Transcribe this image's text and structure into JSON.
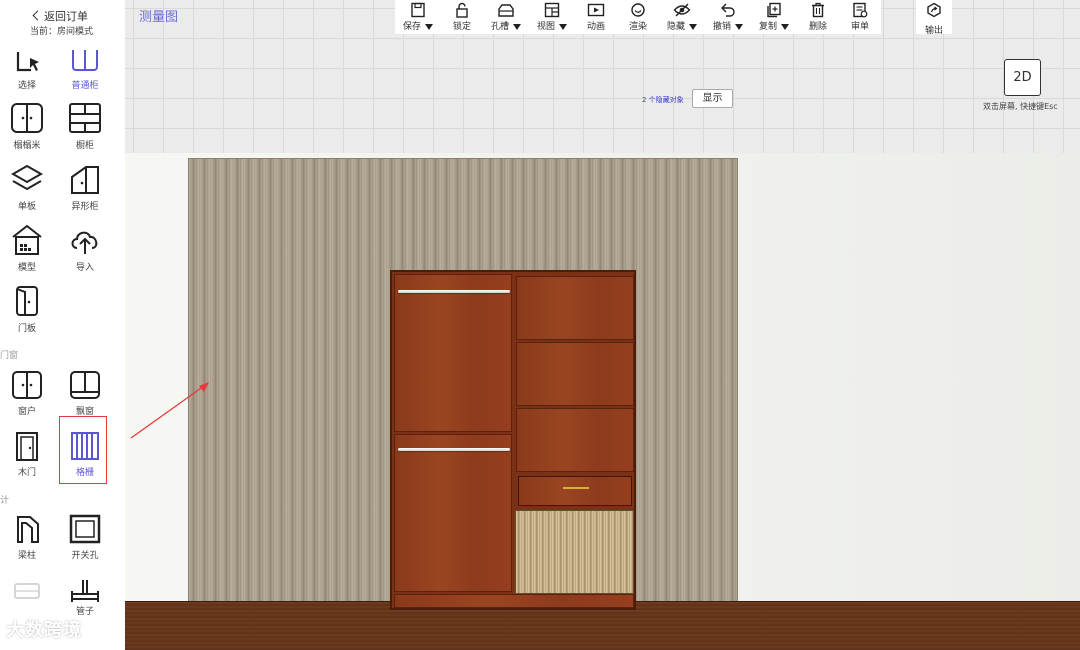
{
  "sidebar": {
    "back_label": "返回订单",
    "mode_text": "当前：房间模式",
    "tools": [
      {
        "label": "选择",
        "icon": "select-cursor-icon"
      },
      {
        "label": "普通柜",
        "icon": "cabinet-icon"
      },
      {
        "label": "榻榻米",
        "icon": "tatami-icon"
      },
      {
        "label": "橱柜",
        "icon": "kitchen-cabinet-icon"
      },
      {
        "label": "单板",
        "icon": "single-board-icon"
      },
      {
        "label": "异形柜",
        "icon": "special-cabinet-icon"
      },
      {
        "label": "模型",
        "icon": "model-house-icon"
      },
      {
        "label": "导入",
        "icon": "upload-cloud-icon"
      },
      {
        "label": "门板",
        "icon": "door-panel-icon"
      },
      {
        "label": "窗户",
        "icon": "window-icon"
      },
      {
        "label": "飘窗",
        "icon": "bay-window-icon"
      },
      {
        "label": "木门",
        "icon": "wood-door-icon"
      },
      {
        "label": "格栅",
        "icon": "grille-icon"
      },
      {
        "label": "梁柱",
        "icon": "beam-column-icon"
      },
      {
        "label": "开关孔",
        "icon": "switch-hole-icon"
      },
      {
        "label": "管子",
        "icon": "pipe-icon"
      }
    ],
    "sections": {
      "doors_windows": "门窗",
      "design": "设计"
    }
  },
  "header": {
    "measure_label": "测量图"
  },
  "toolbar": {
    "items": [
      {
        "label": "保存",
        "icon": "save-icon",
        "dropdown": true
      },
      {
        "label": "锁定",
        "icon": "lock-icon",
        "dropdown": false
      },
      {
        "label": "孔槽",
        "icon": "hole-slot-icon",
        "dropdown": true
      },
      {
        "label": "视图",
        "icon": "view-grid-icon",
        "dropdown": true
      },
      {
        "label": "动画",
        "icon": "animation-icon",
        "dropdown": false
      },
      {
        "label": "渲染",
        "icon": "render-icon",
        "dropdown": false
      },
      {
        "label": "隐藏",
        "icon": "hide-eye-icon",
        "dropdown": true
      },
      {
        "label": "撤销",
        "icon": "undo-icon",
        "dropdown": true
      },
      {
        "label": "复制",
        "icon": "copy-icon",
        "dropdown": true
      },
      {
        "label": "删除",
        "icon": "delete-trash-icon",
        "dropdown": false
      },
      {
        "label": "审单",
        "icon": "review-order-icon",
        "dropdown": false
      }
    ],
    "export_label": "输出"
  },
  "view": {
    "hidden_count": "2 个隐藏对象",
    "show_label": "显示",
    "mode_2d": "2D",
    "hint": "双击屏幕, 快捷键Esc"
  },
  "watermark": "大数跨境",
  "colors": {
    "accent": "#5b57d1",
    "highlight": "#e23b3b",
    "wood": "#8a3a1a"
  }
}
